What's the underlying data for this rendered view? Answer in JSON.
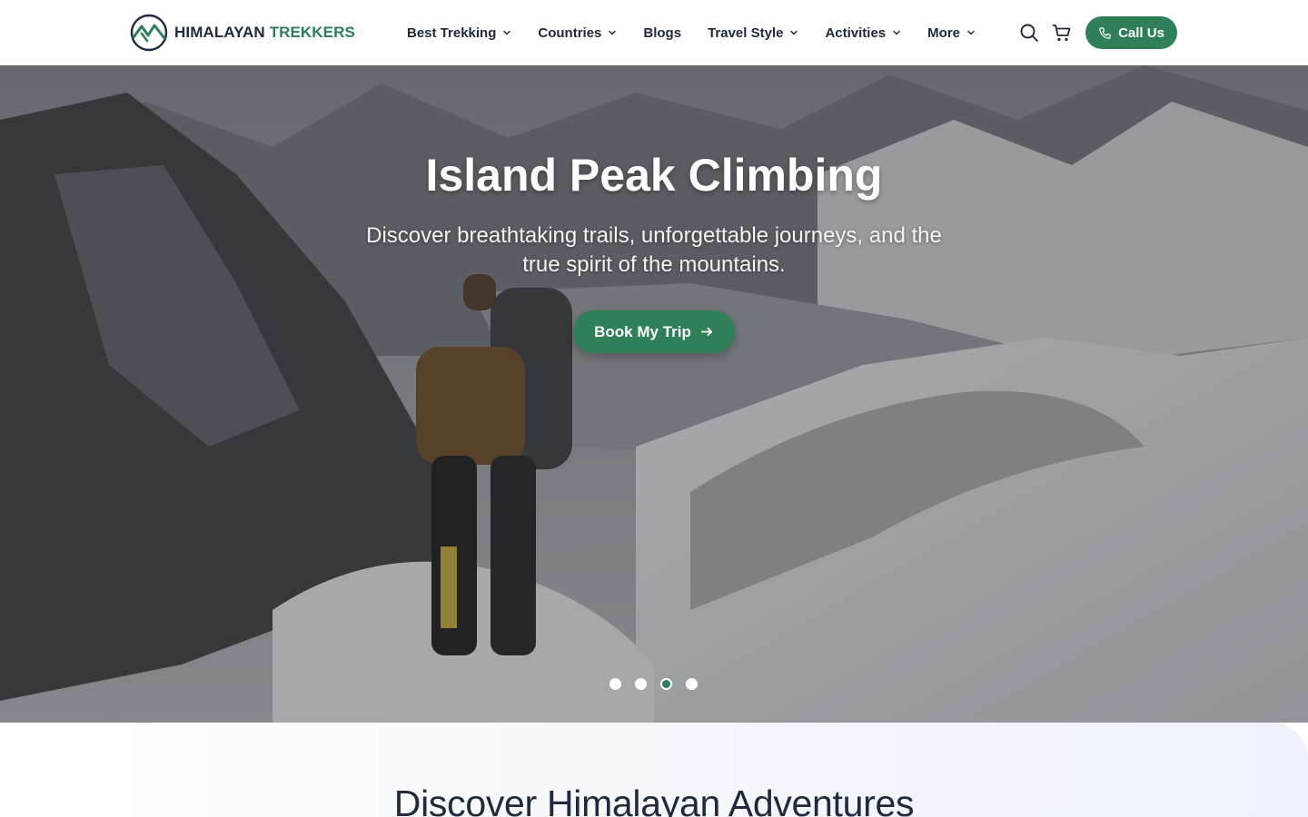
{
  "brand": {
    "name_part1": "HIMALAYAN",
    "name_part2": "TREKKERS",
    "icon": "mountain-logo-icon",
    "colors": {
      "primary_green": "#2f8058",
      "dark_navy": "#1f2a3d"
    }
  },
  "nav": {
    "items": [
      {
        "label": "Best Trekking",
        "has_dropdown": true
      },
      {
        "label": "Countries",
        "has_dropdown": true
      },
      {
        "label": "Blogs",
        "has_dropdown": false
      },
      {
        "label": "Travel Style",
        "has_dropdown": true
      },
      {
        "label": "Activities",
        "has_dropdown": true
      },
      {
        "label": "More",
        "has_dropdown": true
      }
    ]
  },
  "header_actions": {
    "search_icon": "search-icon",
    "cart_icon": "cart-icon",
    "call_label": "Call Us",
    "call_icon": "phone-icon"
  },
  "hero": {
    "title": "Island Peak Climbing",
    "subtitle": "Discover breathtaking trails, unforgettable journeys, and the true spirit of the mountains.",
    "cta_label": "Book My Trip",
    "cta_icon": "arrow-right-icon",
    "slides_total": 4,
    "active_slide": 3
  },
  "discover": {
    "heading": "Discover Himalayan Adventures"
  }
}
